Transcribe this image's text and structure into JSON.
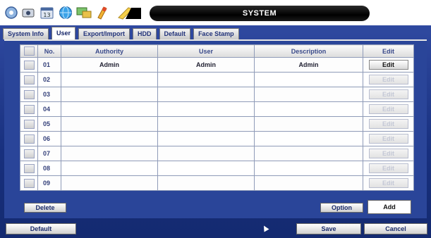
{
  "window": {
    "title": "SYSTEM"
  },
  "toolbar_icons": [
    "settings-icon",
    "camera-icon",
    "calendar-icon",
    "globe-icon",
    "display-icon",
    "power-icon"
  ],
  "tabs": [
    {
      "label": "System Info",
      "active": false
    },
    {
      "label": "User",
      "active": true
    },
    {
      "label": "Export/Import",
      "active": false
    },
    {
      "label": "HDD",
      "active": false
    },
    {
      "label": "Default",
      "active": false
    },
    {
      "label": "Face Stamp",
      "active": false
    }
  ],
  "table": {
    "headers": {
      "no": "No.",
      "authority": "Authority",
      "user": "User",
      "description": "Description",
      "edit": "Edit"
    },
    "rows": [
      {
        "no": "01",
        "authority": "Admin",
        "user": "Admin",
        "description": "Admin",
        "edit": "Edit",
        "enabled": true
      },
      {
        "no": "02",
        "authority": "",
        "user": "",
        "description": "",
        "edit": "Edit",
        "enabled": false
      },
      {
        "no": "03",
        "authority": "",
        "user": "",
        "description": "",
        "edit": "Edit",
        "enabled": false
      },
      {
        "no": "04",
        "authority": "",
        "user": "",
        "description": "",
        "edit": "Edit",
        "enabled": false
      },
      {
        "no": "05",
        "authority": "",
        "user": "",
        "description": "",
        "edit": "Edit",
        "enabled": false
      },
      {
        "no": "06",
        "authority": "",
        "user": "",
        "description": "",
        "edit": "Edit",
        "enabled": false
      },
      {
        "no": "07",
        "authority": "",
        "user": "",
        "description": "",
        "edit": "Edit",
        "enabled": false
      },
      {
        "no": "08",
        "authority": "",
        "user": "",
        "description": "",
        "edit": "Edit",
        "enabled": false
      },
      {
        "no": "09",
        "authority": "",
        "user": "",
        "description": "",
        "edit": "Edit",
        "enabled": false
      }
    ]
  },
  "actions": {
    "delete": "Delete",
    "option": "Option",
    "add": "Add"
  },
  "footer": {
    "default": "Default",
    "save": "Save",
    "cancel": "Cancel"
  },
  "colors": {
    "panel": "#1e3a8c",
    "title_bar": "#000000",
    "header_text": "#3a4a8a"
  }
}
